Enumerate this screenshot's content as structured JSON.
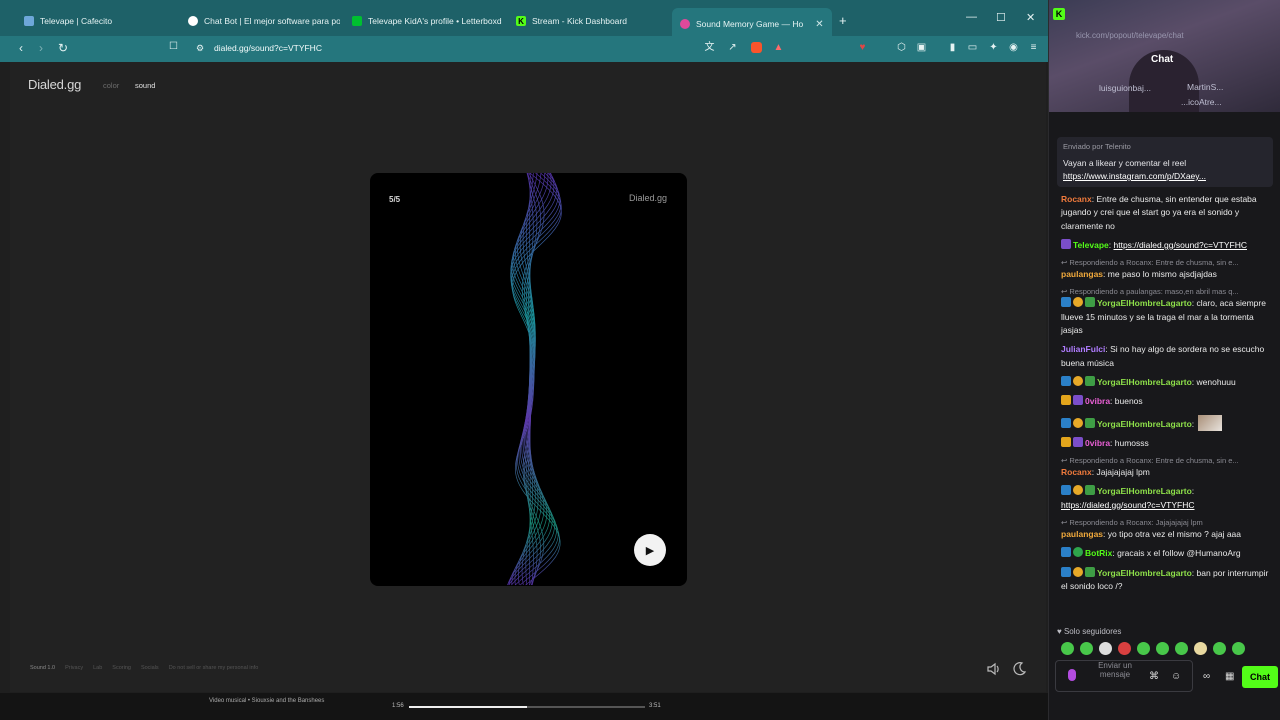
{
  "tabs": [
    {
      "label": "Televape | Cafecito",
      "fav_color": "#6ea7d9"
    },
    {
      "label": "Chat Bot | El mejor software para po",
      "fav_color": "#ffffff"
    },
    {
      "label": "Televape KidA's profile • Letterboxd",
      "fav_color": "#00c030"
    },
    {
      "label": "Stream - Kick Dashboard",
      "fav_color": "#53fc18"
    },
    {
      "label": "Sound Memory Game — Ho",
      "fav_color": "#e0499b"
    }
  ],
  "address": {
    "url": "dialed.gg/sound?c=VTYFHC"
  },
  "page": {
    "logo": "Dialed.gg",
    "nav_color": "color",
    "nav_sound": "sound",
    "card_count": "5/5",
    "card_brand": "Dialed.gg",
    "footer": [
      "Sound 1.0",
      "Privacy",
      "Lab",
      "Scoring",
      "Socials",
      "Do not sell or share my personal info"
    ]
  },
  "taskbar": {
    "media_title": "Video musical • Siouxsie and the Banshees",
    "time_start": "1:56",
    "time_end": "3:51",
    "progress": 0.5
  },
  "chat": {
    "cam_url": "kick.com/popout/televape/chat",
    "title": "Chat",
    "cam_names": [
      "luisguionbaj...",
      "MartinS...",
      "...icoAtre..."
    ],
    "pinned_by": "Enviado por  Telenito",
    "pinned_text": "Vayan a likear y comentar el reel",
    "pinned_link": "https://www.instagram.com/p/DXaey...",
    "messages": [
      {
        "reply": "",
        "user": "Rocanx",
        "color": "#f07a3c",
        "badges": [],
        "text": ": Entre de chusma, sin entender que estaba jugando y crei que el start go ya era el sonido y claramente no",
        "link": ""
      },
      {
        "reply": "",
        "user": "Televape",
        "color": "#53fc18",
        "badges": [
          "b-purple"
        ],
        "text": ": ",
        "link": "https://dialed.gg/sound?c=VTYFHC"
      },
      {
        "reply": "Respondiendo a Rocanx: Entre de chusma, sin e...",
        "user": "paulangas",
        "color": "#f0a93c",
        "badges": [],
        "text": ": me paso lo mismo ajsdjajdas",
        "link": ""
      },
      {
        "reply": "Respondiendo a paulangas: maso,en abril mas q...",
        "user": "YorgaElHombreLagarto",
        "color": "#8ee04a",
        "badges": [
          "b-blue",
          "b-gold",
          "b-leaf"
        ],
        "text": ": claro, aca siempre llueve 15 minutos y se la traga el mar a la tormenta jasjas",
        "link": ""
      },
      {
        "reply": "",
        "user": "JulianFulci",
        "color": "#b07cff",
        "badges": [],
        "text": ": Si no hay algo de sordera no se escucho buena música",
        "link": ""
      },
      {
        "reply": "",
        "user": "YorgaElHombreLagarto",
        "color": "#8ee04a",
        "badges": [
          "b-blue",
          "b-gold",
          "b-leaf"
        ],
        "text": ": wenohuuu",
        "link": ""
      },
      {
        "reply": "",
        "user": "0vibra",
        "color": "#e95fd5",
        "badges": [
          "b-crown",
          "b-purple"
        ],
        "text": ": buenos",
        "link": ""
      },
      {
        "reply": "",
        "user": "YorgaElHombreLagarto",
        "color": "#8ee04a",
        "badges": [
          "b-blue",
          "b-gold",
          "b-leaf"
        ],
        "text": ":",
        "link": "",
        "emote": true
      },
      {
        "reply": "",
        "user": "0vibra",
        "color": "#e95fd5",
        "badges": [
          "b-crown",
          "b-purple"
        ],
        "text": ": humosss",
        "link": ""
      },
      {
        "reply": "Respondiendo a Rocanx: Entre de chusma, sin e...",
        "user": "Rocanx",
        "color": "#f07a3c",
        "badges": [],
        "text": ": Jajajajajaj lpm",
        "link": ""
      },
      {
        "reply": "",
        "user": "YorgaElHombreLagarto",
        "color": "#8ee04a",
        "badges": [
          "b-blue",
          "b-gold",
          "b-leaf"
        ],
        "text": ": ",
        "link": "https://dialed.gg/sound?c=VTYFHC"
      },
      {
        "reply": "Respondiendo a Rocanx: Jajajajajaj lpm",
        "user": "paulangas",
        "color": "#f0a93c",
        "badges": [],
        "text": ": yo tipo otra vez el mismo ? ajaj aaa",
        "link": ""
      },
      {
        "reply": "",
        "user": "BotRix",
        "color": "#53fc18",
        "badges": [
          "b-blue",
          "b-green"
        ],
        "text": ": gracais x el follow @HumanoArg",
        "link": ""
      },
      {
        "reply": "",
        "user": "YorgaElHombreLagarto",
        "color": "#8ee04a",
        "badges": [
          "b-blue",
          "b-gold",
          "b-leaf"
        ],
        "text": ": ban por interrumpir el sonido loco /?",
        "link": ""
      }
    ],
    "followers_only": "♥ Solo seguidores",
    "input_placeholder": "Enviar un mensaje",
    "send_label": "Chat"
  },
  "colors": {
    "tabbar": "#1e6168",
    "accent_kick": "#53fc18"
  }
}
